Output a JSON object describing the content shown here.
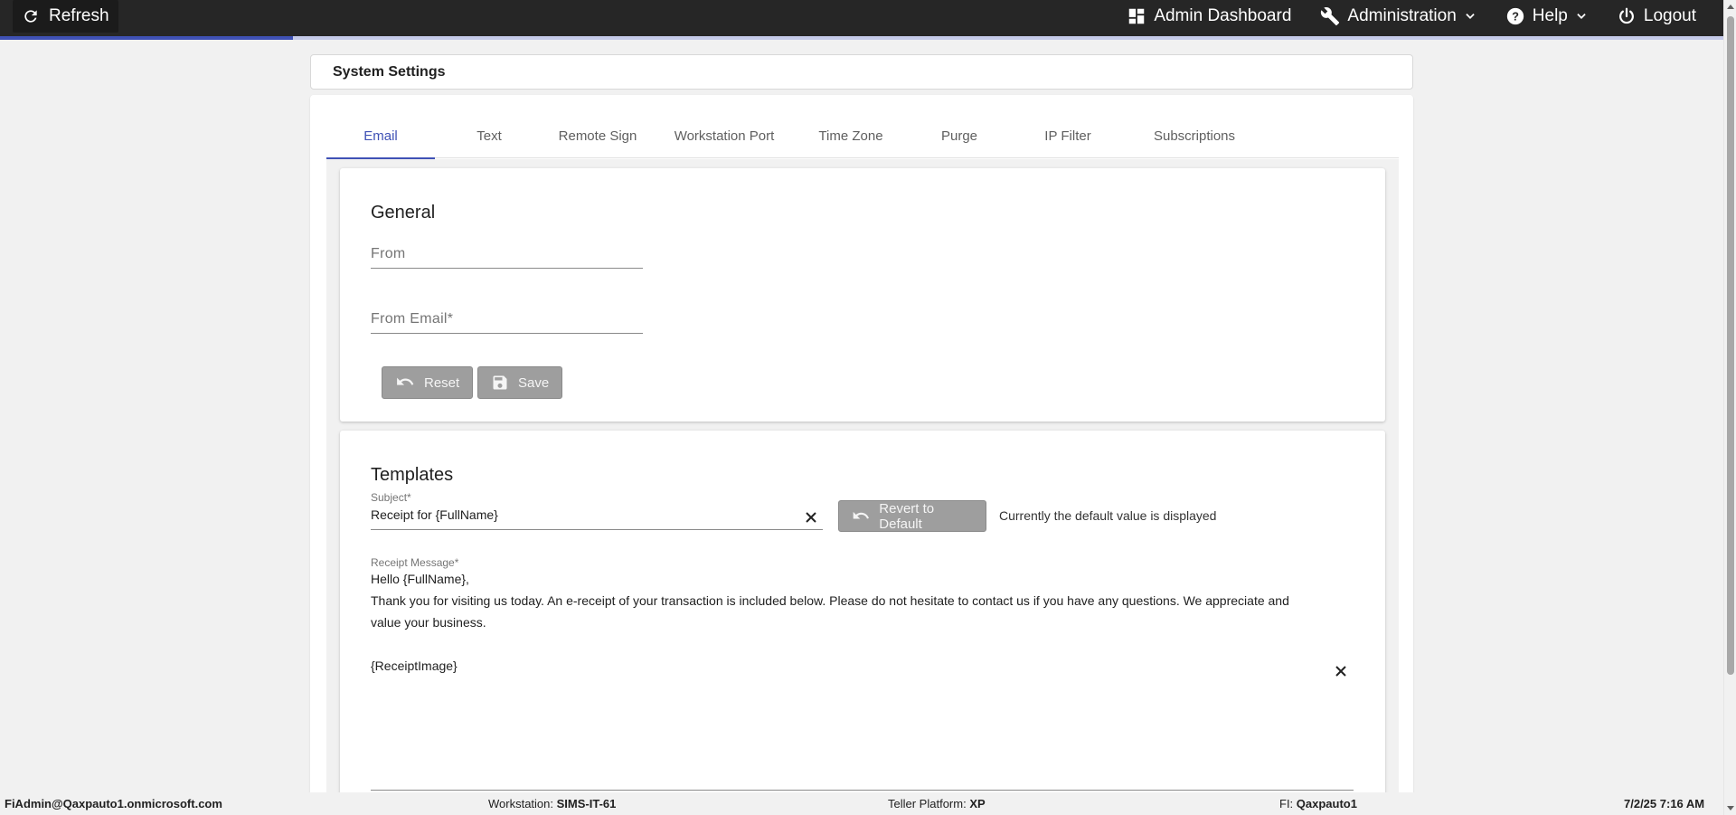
{
  "topbar": {
    "refresh_label": "Refresh",
    "admin_dashboard_label": "Admin Dashboard",
    "administration_label": "Administration",
    "help_label": "Help",
    "logout_label": "Logout",
    "loading_progress_percent": 17
  },
  "page": {
    "title": "System Settings"
  },
  "tabs": [
    {
      "label": "Email",
      "active": true
    },
    {
      "label": "Text"
    },
    {
      "label": "Remote Sign"
    },
    {
      "label": "Workstation Port"
    },
    {
      "label": "Time Zone"
    },
    {
      "label": "Purge"
    },
    {
      "label": "IP Filter"
    },
    {
      "label": "Subscriptions"
    }
  ],
  "general": {
    "title": "General",
    "from_placeholder": "From",
    "from_email_placeholder": "From Email*",
    "reset_label": "Reset",
    "save_label": "Save"
  },
  "templates": {
    "title": "Templates",
    "subject_label": "Subject*",
    "subject_value": "Receipt for {FullName}",
    "revert_label": "Revert to Default",
    "default_note": "Currently the default value is displayed",
    "message_label": "Receipt Message*",
    "message_lines": [
      "Hello {FullName},",
      "Thank you for visiting us today. An e-receipt of your transaction is included below. Please do not hesitate to contact us if you have any questions. We appreciate and value your business.",
      "",
      "{ReceiptImage}"
    ]
  },
  "footer": {
    "user": "FiAdmin@Qaxpauto1.onmicrosoft.com",
    "workstation_label": "Workstation:",
    "workstation_value": "SIMS-IT-61",
    "teller_label": "Teller Platform:",
    "teller_value": "XP",
    "fi_label": "FI:",
    "fi_value": "Qaxpauto1",
    "datetime": "7/2/25 7:16 AM"
  },
  "colors": {
    "topbar": "#262626",
    "accent": "#3f51b5",
    "button_gray": "#9e9e9e",
    "background": "#f1f1f1"
  }
}
